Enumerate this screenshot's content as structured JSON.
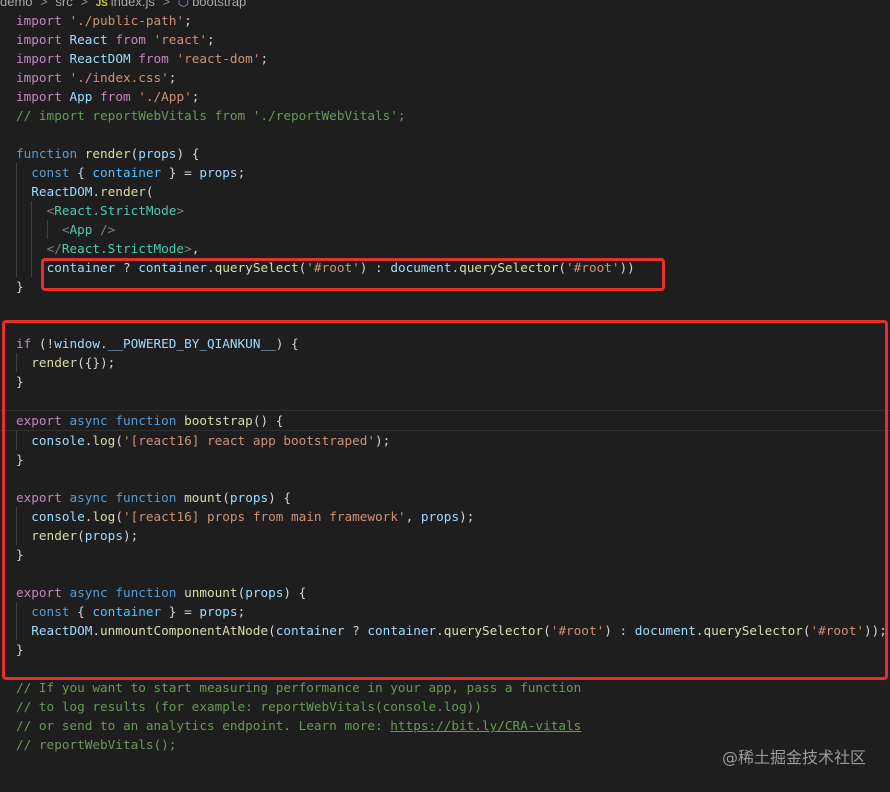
{
  "breadcrumb": {
    "items": [
      "demo",
      "src",
      "index.js",
      "bootstrap"
    ],
    "separator": ">"
  },
  "watermark": "@稀土掘金技术社区",
  "code": {
    "lines": [
      [
        [
          "kwc",
          "import"
        ],
        [
          "p",
          " "
        ],
        [
          "str",
          "'./public-path'"
        ],
        [
          "p",
          ";"
        ]
      ],
      [
        [
          "kwc",
          "import"
        ],
        [
          "p",
          " "
        ],
        [
          "var",
          "React"
        ],
        [
          "p",
          " "
        ],
        [
          "kwc",
          "from"
        ],
        [
          "p",
          " "
        ],
        [
          "str",
          "'react'"
        ],
        [
          "p",
          ";"
        ]
      ],
      [
        [
          "kwc",
          "import"
        ],
        [
          "p",
          " "
        ],
        [
          "var",
          "ReactDOM"
        ],
        [
          "p",
          " "
        ],
        [
          "kwc",
          "from"
        ],
        [
          "p",
          " "
        ],
        [
          "str",
          "'react-dom'"
        ],
        [
          "p",
          ";"
        ]
      ],
      [
        [
          "kwc",
          "import"
        ],
        [
          "p",
          " "
        ],
        [
          "str",
          "'./index.css'"
        ],
        [
          "p",
          ";"
        ]
      ],
      [
        [
          "kwc",
          "import"
        ],
        [
          "p",
          " "
        ],
        [
          "var",
          "App"
        ],
        [
          "p",
          " "
        ],
        [
          "kwc",
          "from"
        ],
        [
          "p",
          " "
        ],
        [
          "str",
          "'./App'"
        ],
        [
          "p",
          ";"
        ]
      ],
      [
        [
          "cm",
          "// import reportWebVitals from './reportWebVitals';"
        ]
      ],
      [],
      [
        [
          "kw",
          "function"
        ],
        [
          "p",
          " "
        ],
        [
          "fn",
          "render"
        ],
        [
          "p",
          "("
        ],
        [
          "var",
          "props"
        ],
        [
          "p",
          ") {"
        ]
      ],
      [
        [
          "p",
          "  "
        ],
        [
          "kw",
          "const"
        ],
        [
          "p",
          " { "
        ],
        [
          "const",
          "container"
        ],
        [
          "p",
          " } = "
        ],
        [
          "var",
          "props"
        ],
        [
          "p",
          ";"
        ]
      ],
      [
        [
          "p",
          "  "
        ],
        [
          "var",
          "ReactDOM"
        ],
        [
          "p",
          "."
        ],
        [
          "fn",
          "render"
        ],
        [
          "p",
          "("
        ]
      ],
      [
        [
          "p",
          "    "
        ],
        [
          "tag",
          "<"
        ],
        [
          "cls",
          "React.StrictMode"
        ],
        [
          "tag",
          ">"
        ]
      ],
      [
        [
          "p",
          "      "
        ],
        [
          "tag",
          "<"
        ],
        [
          "cls",
          "App"
        ],
        [
          "p",
          " "
        ],
        [
          "tag",
          "/>"
        ]
      ],
      [
        [
          "p",
          "    "
        ],
        [
          "tag",
          "</"
        ],
        [
          "cls",
          "React.StrictMode"
        ],
        [
          "tag",
          ">"
        ],
        [
          "p",
          ","
        ]
      ],
      [
        [
          "p",
          "    "
        ],
        [
          "var",
          "container"
        ],
        [
          "p",
          " ? "
        ],
        [
          "var",
          "container"
        ],
        [
          "p",
          "."
        ],
        [
          "fn",
          "querySelect"
        ],
        [
          "p",
          "("
        ],
        [
          "str",
          "'#root'"
        ],
        [
          "p",
          ") : "
        ],
        [
          "var",
          "document"
        ],
        [
          "p",
          "."
        ],
        [
          "fn",
          "querySelector"
        ],
        [
          "p",
          "("
        ],
        [
          "str",
          "'#root'"
        ],
        [
          "p",
          "))"
        ]
      ],
      [
        [
          "p",
          "}"
        ]
      ],
      [],
      [],
      [
        [
          "kwc",
          "if"
        ],
        [
          "p",
          " (!"
        ],
        [
          "var",
          "window"
        ],
        [
          "p",
          "."
        ],
        [
          "var",
          "__POWERED_BY_QIANKUN__"
        ],
        [
          "p",
          ") {"
        ]
      ],
      [
        [
          "p",
          "  "
        ],
        [
          "fn",
          "render"
        ],
        [
          "p",
          "({});"
        ]
      ],
      [
        [
          "p",
          "}"
        ]
      ],
      [],
      [
        [
          "kwc",
          "export"
        ],
        [
          "p",
          " "
        ],
        [
          "kw",
          "async"
        ],
        [
          "p",
          " "
        ],
        [
          "kw",
          "function"
        ],
        [
          "p",
          " "
        ],
        [
          "fn",
          "bootstrap"
        ],
        [
          "p",
          "() {"
        ]
      ],
      [
        [
          "p",
          "  "
        ],
        [
          "var",
          "console"
        ],
        [
          "p",
          "."
        ],
        [
          "fn",
          "log"
        ],
        [
          "p",
          "("
        ],
        [
          "str",
          "'[react16] react app bootstraped'"
        ],
        [
          "p",
          ");"
        ]
      ],
      [
        [
          "p",
          "}"
        ]
      ],
      [],
      [
        [
          "kwc",
          "export"
        ],
        [
          "p",
          " "
        ],
        [
          "kw",
          "async"
        ],
        [
          "p",
          " "
        ],
        [
          "kw",
          "function"
        ],
        [
          "p",
          " "
        ],
        [
          "fn",
          "mount"
        ],
        [
          "p",
          "("
        ],
        [
          "var",
          "props"
        ],
        [
          "p",
          ") {"
        ]
      ],
      [
        [
          "p",
          "  "
        ],
        [
          "var",
          "console"
        ],
        [
          "p",
          "."
        ],
        [
          "fn",
          "log"
        ],
        [
          "p",
          "("
        ],
        [
          "str",
          "'[react16] props from main framework'"
        ],
        [
          "p",
          ", "
        ],
        [
          "var",
          "props"
        ],
        [
          "p",
          ");"
        ]
      ],
      [
        [
          "p",
          "  "
        ],
        [
          "fn",
          "render"
        ],
        [
          "p",
          "("
        ],
        [
          "var",
          "props"
        ],
        [
          "p",
          ");"
        ]
      ],
      [
        [
          "p",
          "}"
        ]
      ],
      [],
      [
        [
          "kwc",
          "export"
        ],
        [
          "p",
          " "
        ],
        [
          "kw",
          "async"
        ],
        [
          "p",
          " "
        ],
        [
          "kw",
          "function"
        ],
        [
          "p",
          " "
        ],
        [
          "fn",
          "unmount"
        ],
        [
          "p",
          "("
        ],
        [
          "var",
          "props"
        ],
        [
          "p",
          ") {"
        ]
      ],
      [
        [
          "p",
          "  "
        ],
        [
          "kw",
          "const"
        ],
        [
          "p",
          " { "
        ],
        [
          "const",
          "container"
        ],
        [
          "p",
          " } = "
        ],
        [
          "var",
          "props"
        ],
        [
          "p",
          ";"
        ]
      ],
      [
        [
          "p",
          "  "
        ],
        [
          "var",
          "ReactDOM"
        ],
        [
          "p",
          "."
        ],
        [
          "fn",
          "unmountComponentAtNode"
        ],
        [
          "p",
          "("
        ],
        [
          "var",
          "container"
        ],
        [
          "p",
          " ? "
        ],
        [
          "var",
          "container"
        ],
        [
          "p",
          "."
        ],
        [
          "fn",
          "querySelector"
        ],
        [
          "p",
          "("
        ],
        [
          "str",
          "'#root'"
        ],
        [
          "p",
          ") : "
        ],
        [
          "var",
          "document"
        ],
        [
          "p",
          "."
        ],
        [
          "fn",
          "querySelector"
        ],
        [
          "p",
          "("
        ],
        [
          "str",
          "'#root'"
        ],
        [
          "p",
          "));"
        ]
      ],
      [
        [
          "p",
          "}"
        ]
      ],
      [],
      [
        [
          "cm",
          "// If you want to start measuring performance in your app, pass a function"
        ]
      ],
      [
        [
          "cm",
          "// to log results (for example: reportWebVitals(console.log))"
        ]
      ],
      [
        [
          "cm",
          "// or send to an analytics endpoint. Learn more: "
        ],
        [
          "link",
          "https://bit.ly/CRA-vitals"
        ]
      ],
      [
        [
          "cm",
          "// reportWebVitals();"
        ]
      ]
    ]
  }
}
